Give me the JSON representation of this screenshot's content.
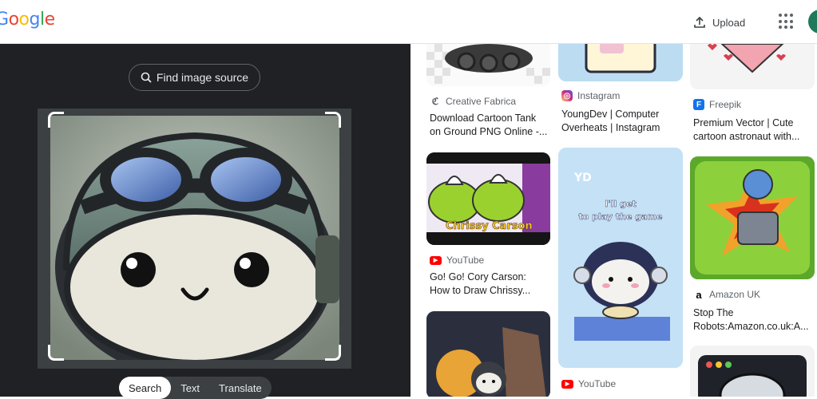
{
  "header": {
    "logo_letters": [
      {
        "ch": "G",
        "color": "#4285F4"
      },
      {
        "ch": "o",
        "color": "#EA4335"
      },
      {
        "ch": "o",
        "color": "#FBBC05"
      },
      {
        "ch": "g",
        "color": "#4285F4"
      },
      {
        "ch": "l",
        "color": "#34A853"
      },
      {
        "ch": "e",
        "color": "#EA4335"
      }
    ],
    "upload_label": "Upload",
    "upload_icon": "upload-icon",
    "apps_icon": "apps-grid-icon"
  },
  "lens": {
    "find_source_label": "Find image source",
    "modes": [
      "Search",
      "Text",
      "Translate"
    ],
    "active_mode": "Search"
  },
  "results": [
    {
      "source": "Creative Fabrica",
      "title_lines": [
        "Download Cartoon Tank",
        "on Ground PNG Online -..."
      ],
      "icon_color": "#5f6368"
    },
    {
      "source": "Instagram",
      "title_lines": [
        "YoungDev | Computer",
        "Overheats | Instagram"
      ],
      "icon_color": "#d62976"
    },
    {
      "source": "Freepik",
      "title_lines": [
        "Premium Vector | Cute",
        "cartoon astronaut with..."
      ],
      "icon_color": "#1273eb"
    },
    {
      "source": "YouTube",
      "title_lines": [
        "Go! Go! Cory Carson:",
        "How to Draw Chrissy..."
      ],
      "icon_color": "#ff0000"
    },
    {
      "source": "Amazon UK",
      "title_lines": [
        "Stop The",
        "Robots:Amazon.co.uk:A..."
      ],
      "icon_color": "#000000"
    },
    {
      "source": "YouTube",
      "title_lines": [],
      "icon_color": "#ff0000"
    }
  ],
  "thumb_texts": {
    "yd_caption_line1": "I'll get",
    "yd_caption_line2": "to play the game",
    "chrissy_caption": "Chrissy Carson",
    "yd_logo": "YD"
  }
}
